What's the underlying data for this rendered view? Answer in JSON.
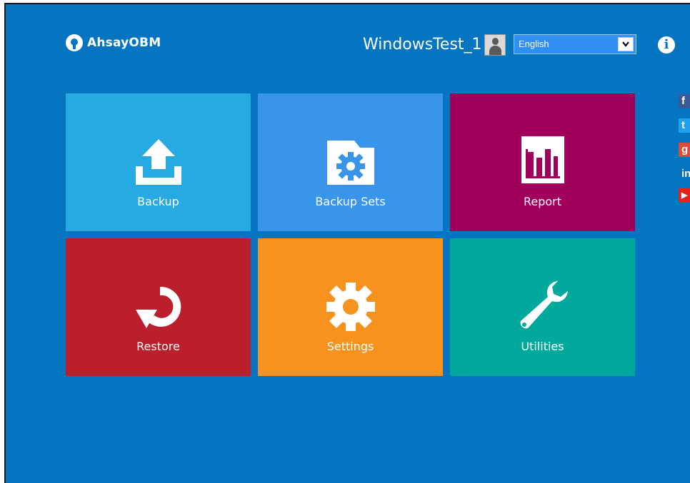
{
  "header": {
    "brand": "AhsayOBM",
    "username": "WindowsTest_1",
    "language": "English"
  },
  "tiles": [
    {
      "label": "Backup",
      "color": "#27a9e1",
      "icon": "upload-icon"
    },
    {
      "label": "Backup Sets",
      "color": "#3895ea",
      "icon": "folder-gear-icon"
    },
    {
      "label": "Report",
      "color": "#a0005b",
      "icon": "bar-chart-icon"
    },
    {
      "label": "Restore",
      "color": "#bb1f2b",
      "icon": "restore-icon"
    },
    {
      "label": "Settings",
      "color": "#f7921e",
      "icon": "gear-icon"
    },
    {
      "label": "Utilities",
      "color": "#00a99c",
      "icon": "wrench-icon"
    }
  ],
  "social": [
    {
      "icon": "facebook-icon",
      "glyph": "f",
      "color": "#3b5998"
    },
    {
      "icon": "twitter-icon",
      "glyph": "t",
      "color": "#1da1f2"
    },
    {
      "icon": "google-plus-icon",
      "glyph": "g",
      "color": "#dd4b39"
    },
    {
      "icon": "linkedin-icon",
      "glyph": "in",
      "color": "#0575c2"
    },
    {
      "icon": "youtube-icon",
      "glyph": "▶",
      "color": "#e62117"
    }
  ]
}
